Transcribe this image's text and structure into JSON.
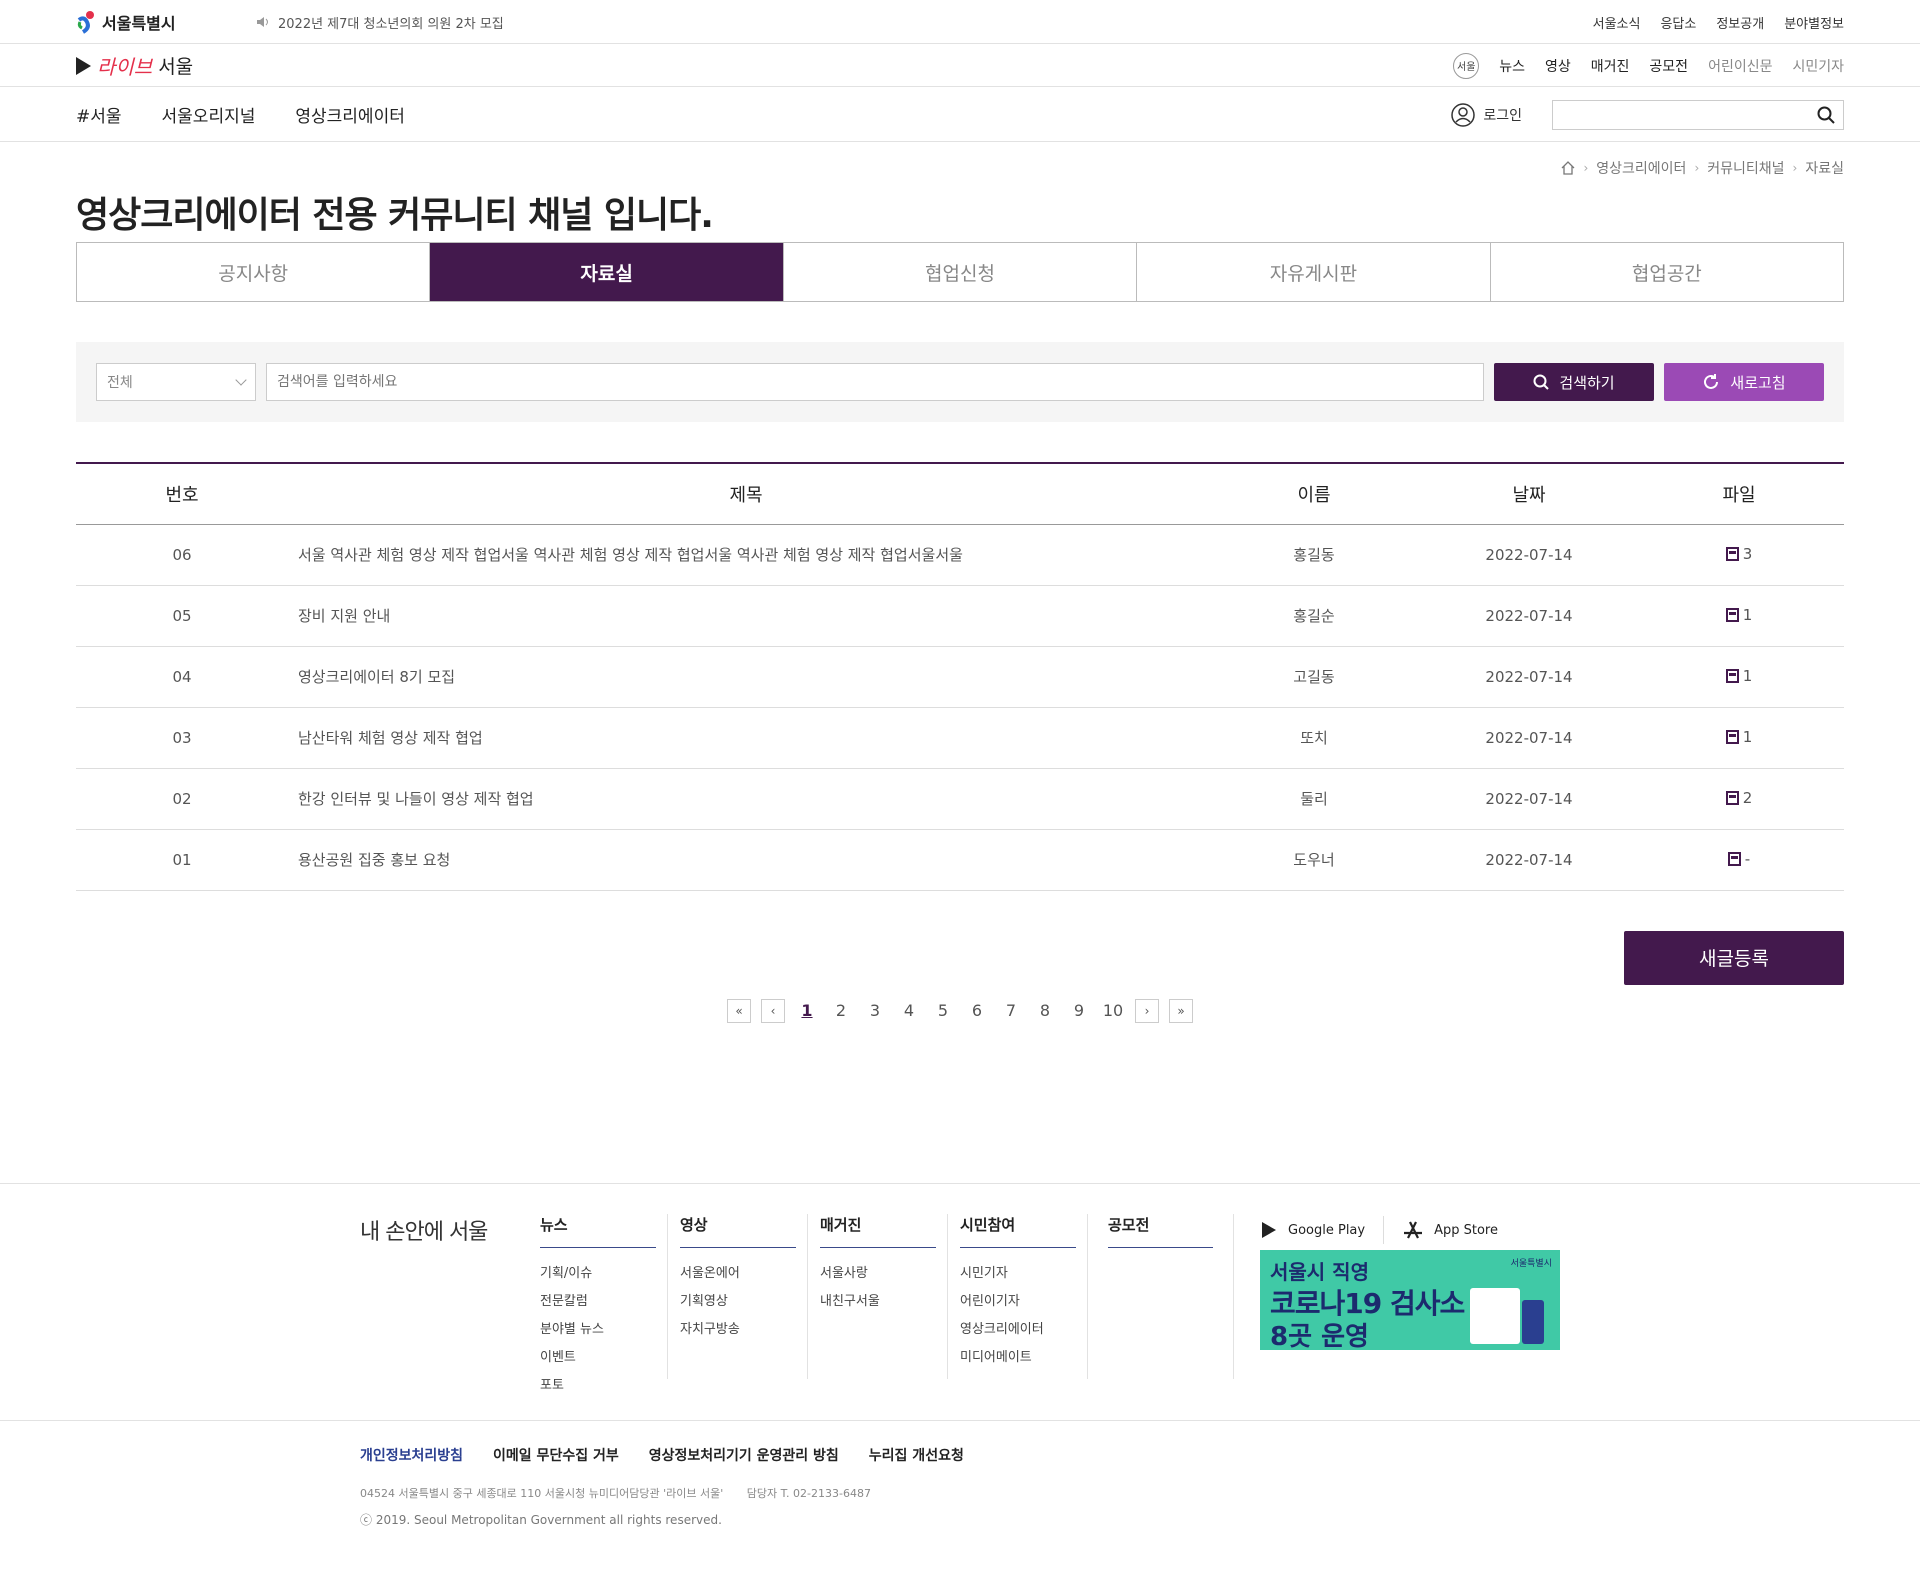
{
  "header": {
    "seoul_logo": "서울특별시",
    "notice": "2022년 제7대 청소년의회 의원 2차 모집",
    "util_links": [
      "서울소식",
      "응답소",
      "정보공개",
      "분야별정보"
    ],
    "live_logo": {
      "script": "라이브",
      "seoul": "서울"
    },
    "circle_logo": "서울",
    "sub_menu": [
      "뉴스",
      "영상",
      "매거진",
      "공모전"
    ],
    "sub_menu_grey": [
      "어린이신문",
      "시민기자"
    ],
    "nav": [
      "#서울",
      "서울오리지널",
      "영상크리에이터"
    ],
    "login": "로그인"
  },
  "breadcrumb": [
    "영상크리에이터",
    "커뮤니티채널",
    "자료실"
  ],
  "page_title": "영상크리에이터 전용 커뮤니티 채널 입니다.",
  "tabs": [
    {
      "label": "공지사항",
      "active": false
    },
    {
      "label": "자료실",
      "active": true
    },
    {
      "label": "협업신청",
      "active": false
    },
    {
      "label": "자유게시판",
      "active": false
    },
    {
      "label": "협업공간",
      "active": false
    }
  ],
  "filter": {
    "select_value": "전체",
    "search_placeholder": "검색어를 입력하세요",
    "search_button": "검색하기",
    "refresh_button": "새로고침"
  },
  "table": {
    "headers": [
      "번호",
      "제목",
      "이름",
      "날짜",
      "파일"
    ],
    "rows": [
      {
        "no": "06",
        "title": "서울 역사관 체험 영상 제작 협업서울 역사관 체험 영상 제작 협업서울 역사관 체험 영상 제작 협업서울서울",
        "name": "홍길동",
        "date": "2022-07-14",
        "files": "3"
      },
      {
        "no": "05",
        "title": "장비 지원 안내",
        "name": "홍길순",
        "date": "2022-07-14",
        "files": "1"
      },
      {
        "no": "04",
        "title": "영상크리에이터 8기 모집",
        "name": "고길동",
        "date": "2022-07-14",
        "files": "1"
      },
      {
        "no": "03",
        "title": "남산타워 체험 영상 제작 협업",
        "name": "또치",
        "date": "2022-07-14",
        "files": "1"
      },
      {
        "no": "02",
        "title": "한강 인터뷰 및 나들이 영상 제작 협업",
        "name": "둘리",
        "date": "2022-07-14",
        "files": "2"
      },
      {
        "no": "01",
        "title": "용산공원 집중 홍보 요청",
        "name": "도우너",
        "date": "2022-07-14",
        "files": "-"
      }
    ]
  },
  "write_button": "새글등록",
  "pagination": {
    "current": "1",
    "pages": [
      "1",
      "2",
      "3",
      "4",
      "5",
      "6",
      "7",
      "8",
      "9",
      "10"
    ]
  },
  "footer": {
    "slogan": "내 손안에 서울",
    "columns": [
      {
        "title": "뉴스",
        "items": [
          "기획/이슈",
          "전문칼럼",
          "분야별 뉴스",
          "이벤트",
          "포토"
        ]
      },
      {
        "title": "영상",
        "items": [
          "서울온에어",
          "기획영상",
          "자치구방송"
        ]
      },
      {
        "title": "매거진",
        "items": [
          "서울사랑",
          "내친구서울"
        ]
      },
      {
        "title": "시민참여",
        "items": [
          "시민기자",
          "어린이기자",
          "영상크리에이터",
          "미디어메이트"
        ]
      },
      {
        "title": "공모전",
        "items": []
      }
    ],
    "stores": [
      "Google Play",
      "App Store"
    ],
    "banner": {
      "line1": "서울시 직영",
      "line2": "코로나19 검사소",
      "line3": "8곳 운영",
      "brand": "서울특별시"
    },
    "links": [
      "개인정보처리방침",
      "이메일 무단수집 거부",
      "영상정보처리기기 운영관리 방침",
      "누리집 개선요청"
    ],
    "address": "04524 서울특별시 중구 세종대로 110 서울시청 뉴미디어담당관 '라이브 서울'",
    "contact": "담당자 T. 02-2133-6487",
    "copyright": "ⓒ 2019. Seoul Metropolitan Government all rights reserved."
  },
  "colors": {
    "primary": "#43194d",
    "accent": "#9b4ab5",
    "footer_link": "#2a3f90"
  }
}
